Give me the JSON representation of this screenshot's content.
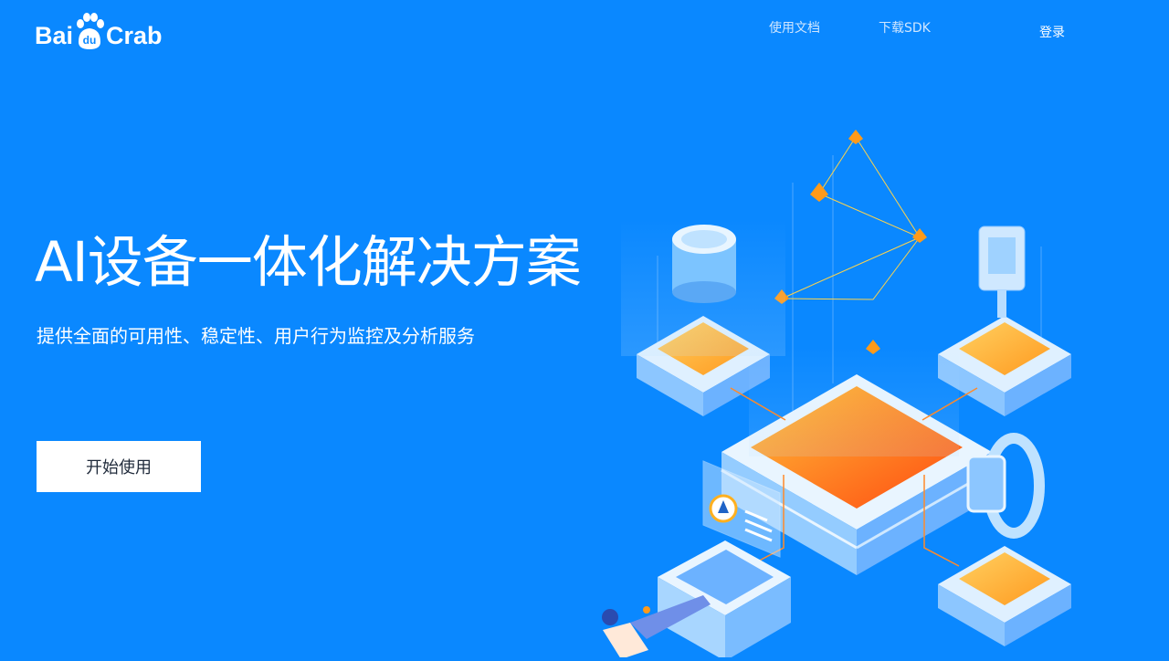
{
  "brand": {
    "logo_left": "Bai",
    "logo_paw": "du",
    "logo_right": "Crab"
  },
  "nav": {
    "docs": "使用文档",
    "sdk": "下载SDK",
    "login": "登录"
  },
  "hero": {
    "title": "AI设备一体化解决方案",
    "subtitle": "提供全面的可用性、稳定性、用户行为监控及分析服务",
    "cta": "开始使用"
  },
  "colors": {
    "background": "#0a88ff",
    "cta_bg": "#ffffff",
    "cta_text": "#1f2a3a",
    "accent_orange": "#ff7a1a"
  },
  "icons": [
    "baidu-paw-logo",
    "isometric-ai-device-illustration"
  ]
}
